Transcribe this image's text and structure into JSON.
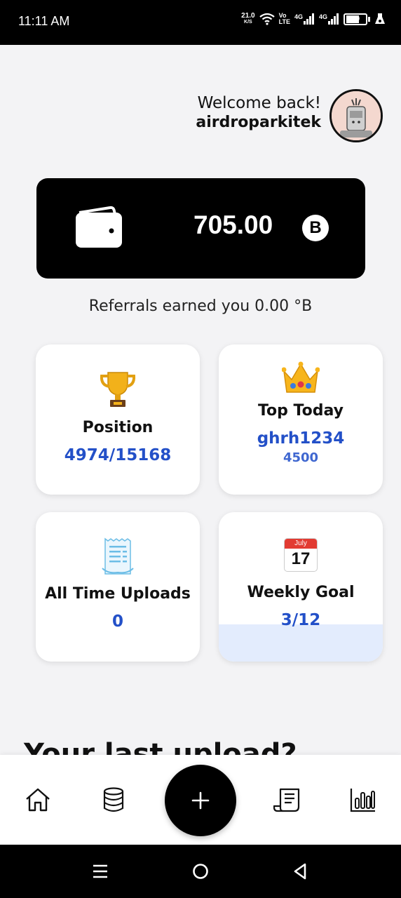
{
  "status_bar": {
    "time": "11:11 AM",
    "net_speed": "21.0",
    "net_speed_unit": "K/S",
    "volte_top": "Vo",
    "volte_bottom": "LTE",
    "sim1": "4G",
    "sim2": "4G",
    "battery": "60"
  },
  "header": {
    "greeting": "Welcome back!",
    "username": "airdroparkitek",
    "avatar_icon": "user-avatar"
  },
  "balance": {
    "amount": "705.00",
    "currency_symbol": "B",
    "wallet_icon": "wallet-icon",
    "coin_icon": "coin-icon"
  },
  "referrals_text": "Referrals earned you 0.00 °B",
  "stats": {
    "position": {
      "icon": "trophy-icon",
      "title": "Position",
      "value": "4974/15168"
    },
    "top_today": {
      "icon": "crown-icon",
      "title": "Top Today",
      "value": "ghrh1234",
      "sub": "4500"
    },
    "uploads": {
      "icon": "receipt-icon",
      "title": "All Time Uploads",
      "value": "0"
    },
    "weekly_goal": {
      "icon": "calendar-icon",
      "title": "Weekly Goal",
      "value": "3/12",
      "calendar_month": "July",
      "calendar_day": "17",
      "progress": 0.25
    }
  },
  "partial_heading": "Your last upload?",
  "bottom_nav": {
    "items": [
      "home-icon",
      "database-icon",
      "add-icon",
      "receipt-nav-icon",
      "chart-icon"
    ]
  },
  "colors": {
    "accent_blue": "#2350c8",
    "card_bg": "#ffffff",
    "balance_bg": "#000000",
    "goal_fill": "#e3ecfd"
  }
}
